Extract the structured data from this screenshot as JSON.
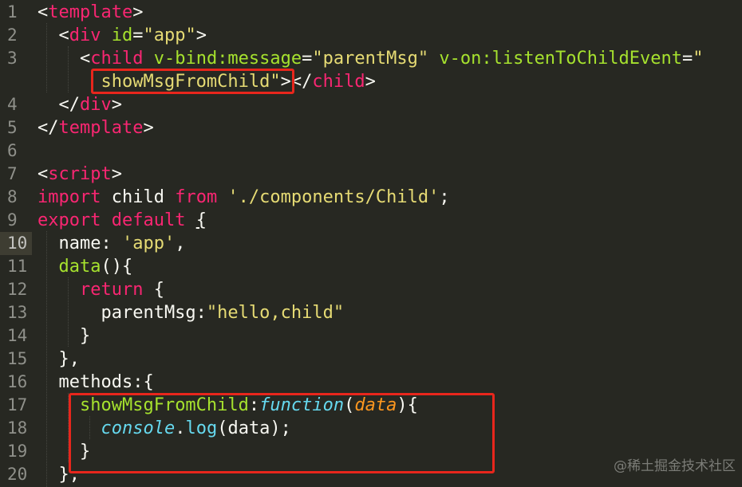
{
  "editor": {
    "lines": [
      {
        "number": "1",
        "tokens": [
          {
            "text": "<",
            "cls": "tk-punc"
          },
          {
            "text": "template",
            "cls": "tk-tag"
          },
          {
            "text": ">",
            "cls": "tk-punc"
          }
        ]
      },
      {
        "number": "2",
        "tokens": [
          {
            "text": "  <",
            "cls": "tk-punc"
          },
          {
            "text": "div",
            "cls": "tk-tag"
          },
          {
            "text": " ",
            "cls": "tk-plain"
          },
          {
            "text": "id",
            "cls": "tk-attr"
          },
          {
            "text": "=",
            "cls": "tk-punc"
          },
          {
            "text": "\"app\"",
            "cls": "tk-str"
          },
          {
            "text": ">",
            "cls": "tk-punc"
          }
        ]
      },
      {
        "number": "3",
        "tokens": [
          {
            "text": "    <",
            "cls": "tk-punc"
          },
          {
            "text": "child",
            "cls": "tk-tag"
          },
          {
            "text": " ",
            "cls": "tk-plain"
          },
          {
            "text": "v-bind:message",
            "cls": "tk-attr"
          },
          {
            "text": "=",
            "cls": "tk-punc"
          },
          {
            "text": "\"parentMsg\"",
            "cls": "tk-str"
          },
          {
            "text": " ",
            "cls": "tk-plain"
          },
          {
            "text": "v-on:listenToChildEvent",
            "cls": "tk-attr"
          },
          {
            "text": "=",
            "cls": "tk-punc"
          },
          {
            "text": "\"",
            "cls": "tk-str"
          }
        ]
      },
      {
        "number": "",
        "tokens": [
          {
            "text": "      showMsgFromChild\"",
            "cls": "tk-str"
          },
          {
            "text": "></",
            "cls": "tk-punc"
          },
          {
            "text": "child",
            "cls": "tk-tag"
          },
          {
            "text": ">",
            "cls": "tk-punc"
          }
        ]
      },
      {
        "number": "4",
        "tokens": [
          {
            "text": "  </",
            "cls": "tk-punc"
          },
          {
            "text": "div",
            "cls": "tk-tag"
          },
          {
            "text": ">",
            "cls": "tk-punc"
          }
        ]
      },
      {
        "number": "5",
        "tokens": [
          {
            "text": "</",
            "cls": "tk-punc"
          },
          {
            "text": "template",
            "cls": "tk-tag"
          },
          {
            "text": ">",
            "cls": "tk-punc"
          }
        ]
      },
      {
        "number": "6",
        "tokens": []
      },
      {
        "number": "7",
        "tokens": [
          {
            "text": "<",
            "cls": "tk-punc"
          },
          {
            "text": "script",
            "cls": "tk-tag"
          },
          {
            "text": ">",
            "cls": "tk-punc"
          }
        ]
      },
      {
        "number": "8",
        "tokens": [
          {
            "text": "import",
            "cls": "tk-kw"
          },
          {
            "text": " child ",
            "cls": "tk-plain"
          },
          {
            "text": "from",
            "cls": "tk-kw"
          },
          {
            "text": " ",
            "cls": "tk-plain"
          },
          {
            "text": "'./components/Child'",
            "cls": "tk-str"
          },
          {
            "text": ";",
            "cls": "tk-punc"
          }
        ]
      },
      {
        "number": "9",
        "tokens": [
          {
            "text": "export",
            "cls": "tk-kw"
          },
          {
            "text": " ",
            "cls": "tk-plain"
          },
          {
            "text": "default",
            "cls": "tk-kw"
          },
          {
            "text": " ",
            "cls": "tk-plain"
          },
          {
            "text": "{",
            "cls": "tk-punc tk-ul"
          }
        ]
      },
      {
        "number": "10",
        "active": true,
        "tokens": [
          {
            "text": "  name: ",
            "cls": "tk-plain"
          },
          {
            "text": "'app'",
            "cls": "tk-str"
          },
          {
            "text": ",",
            "cls": "tk-punc"
          }
        ]
      },
      {
        "number": "11",
        "tokens": [
          {
            "text": "  ",
            "cls": "tk-plain"
          },
          {
            "text": "data",
            "cls": "tk-fn"
          },
          {
            "text": "(){",
            "cls": "tk-punc"
          }
        ]
      },
      {
        "number": "12",
        "tokens": [
          {
            "text": "    ",
            "cls": "tk-plain"
          },
          {
            "text": "return",
            "cls": "tk-kw"
          },
          {
            "text": " {",
            "cls": "tk-punc"
          }
        ]
      },
      {
        "number": "13",
        "tokens": [
          {
            "text": "      parentMsg:",
            "cls": "tk-plain"
          },
          {
            "text": "\"hello,child\"",
            "cls": "tk-str"
          }
        ]
      },
      {
        "number": "14",
        "tokens": [
          {
            "text": "    }",
            "cls": "tk-punc"
          }
        ]
      },
      {
        "number": "15",
        "tokens": [
          {
            "text": "  },",
            "cls": "tk-punc"
          }
        ]
      },
      {
        "number": "16",
        "tokens": [
          {
            "text": "  methods:{",
            "cls": "tk-plain"
          }
        ]
      },
      {
        "number": "17",
        "tokens": [
          {
            "text": "    ",
            "cls": "tk-plain"
          },
          {
            "text": "showMsgFromChild",
            "cls": "tk-fn"
          },
          {
            "text": ":",
            "cls": "tk-punc"
          },
          {
            "text": "function",
            "cls": "tk-storage"
          },
          {
            "text": "(",
            "cls": "tk-punc"
          },
          {
            "text": "data",
            "cls": "tk-param"
          },
          {
            "text": "){",
            "cls": "tk-punc"
          }
        ]
      },
      {
        "number": "18",
        "tokens": [
          {
            "text": "      ",
            "cls": "tk-plain"
          },
          {
            "text": "console",
            "cls": "tk-support"
          },
          {
            "text": ".",
            "cls": "tk-punc"
          },
          {
            "text": "log",
            "cls": "tk-method"
          },
          {
            "text": "(data);",
            "cls": "tk-punc"
          }
        ]
      },
      {
        "number": "19",
        "tokens": [
          {
            "text": "    }",
            "cls": "tk-punc"
          }
        ]
      },
      {
        "number": "20",
        "tokens": [
          {
            "text": "  },",
            "cls": "tk-punc"
          }
        ]
      }
    ]
  },
  "watermark": "@稀土掘金技术社区",
  "colors": {
    "background": "#272822",
    "highlight_box": "#e8261c",
    "tag": "#f92672",
    "string": "#e6db74",
    "attribute": "#a6e22e"
  }
}
